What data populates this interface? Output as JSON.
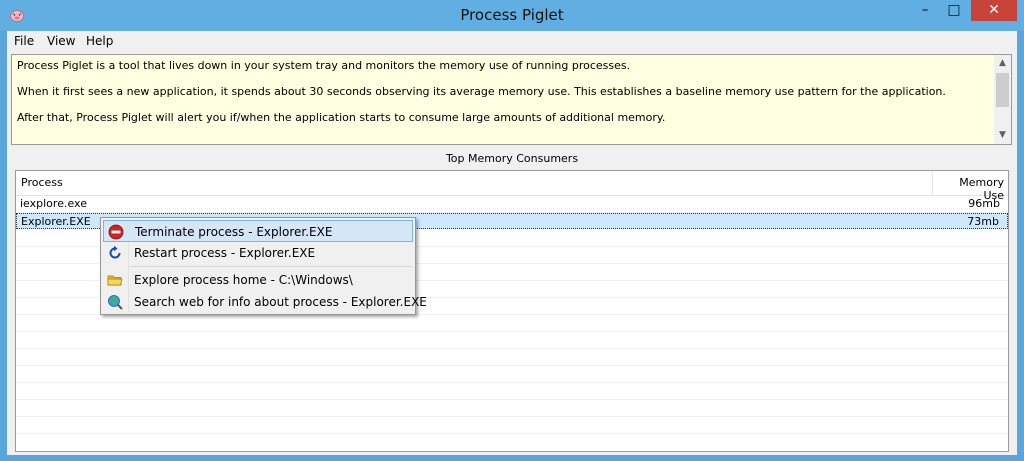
{
  "window": {
    "title": "Process Piglet",
    "controls": {
      "minimize": "–",
      "maximize": "□",
      "close": "✕"
    }
  },
  "menu": {
    "file": "File",
    "view": "View",
    "help": "Help"
  },
  "description": {
    "line1": "Process Piglet is a tool that lives down in your system tray and monitors the memory use of running processes.",
    "line2": "When it first sees a new application, it spends about 30 seconds observing its average memory use.  This establishes a baseline memory use pattern for the application.",
    "line3": "After that, Process Piglet will alert you if/when the application starts to consume large amounts of additional memory."
  },
  "section_label": "Top Memory Consumers",
  "list": {
    "headers": {
      "process": "Process",
      "memory": "Memory Use"
    },
    "rows": [
      {
        "process": "iexplore.exe",
        "memory": "96mb"
      },
      {
        "process": "Explorer.EXE",
        "memory": "73mb"
      }
    ]
  },
  "context_menu": {
    "terminate": "Terminate process - Explorer.EXE",
    "restart": "Restart process - Explorer.EXE",
    "explore": "Explore process home - C:\\Windows\\",
    "search": "Search web for info about process - Explorer.EXE"
  },
  "icons": {
    "app": "pig-icon",
    "terminate": "stop-sign-icon",
    "restart": "refresh-icon",
    "explore": "folder-icon",
    "search": "globe-search-icon"
  },
  "colors": {
    "titlebar": "#61aee3",
    "close": "#c7443a",
    "info_bg": "#ffffe1",
    "selection": "#cde8ff"
  }
}
